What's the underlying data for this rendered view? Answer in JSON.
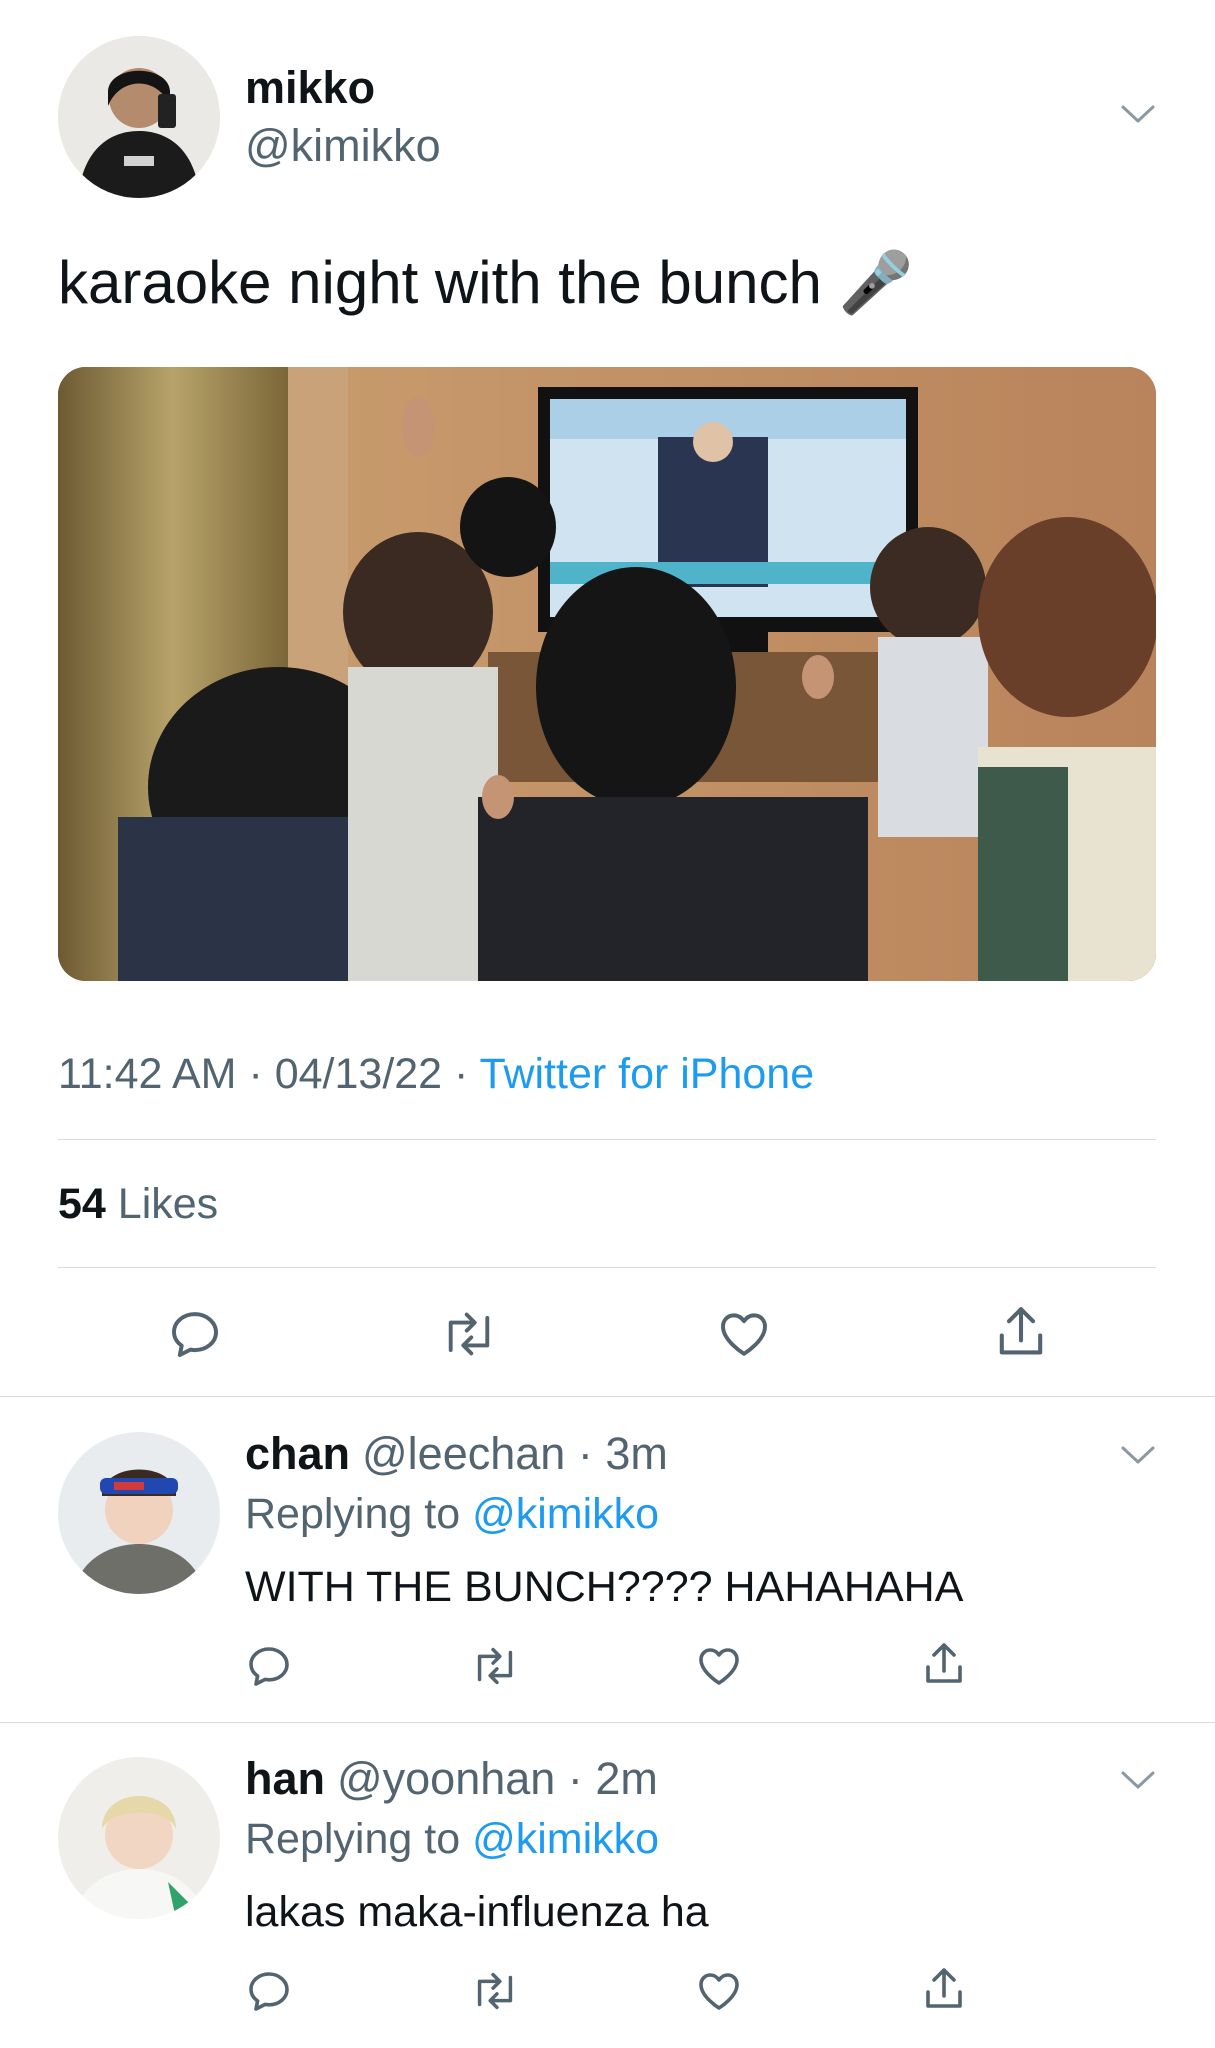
{
  "main_tweet": {
    "author_name": "mikko",
    "author_handle": "@kimikko",
    "text": "karaoke night with the bunch",
    "emoji": "🎤",
    "time": "11:42 AM",
    "separator": " · ",
    "date": "04/13/22",
    "source": "Twitter for iPhone",
    "likes_count": "54",
    "likes_label": " Likes"
  },
  "replies": [
    {
      "author_name": "chan",
      "author_handle": "@leechan",
      "time_ago": "3m",
      "replying_label": "Replying to ",
      "replying_to": "@kimikko",
      "text": "WITH THE BUNCH???? HAHAHAHA"
    },
    {
      "author_name": "han",
      "author_handle": "@yoonhan",
      "time_ago": "2m",
      "replying_label": "Replying to ",
      "replying_to": "@kimikko",
      "text": "lakas maka-influenza ha"
    }
  ],
  "icons": {
    "reply": "reply-icon",
    "retweet": "retweet-icon",
    "like": "heart-icon",
    "share": "share-icon",
    "more": "chevron-down-icon"
  },
  "colors": {
    "link": "#1d9bf0",
    "muted": "#536471",
    "text": "#0f1419",
    "divider": "#d7dbdf"
  }
}
